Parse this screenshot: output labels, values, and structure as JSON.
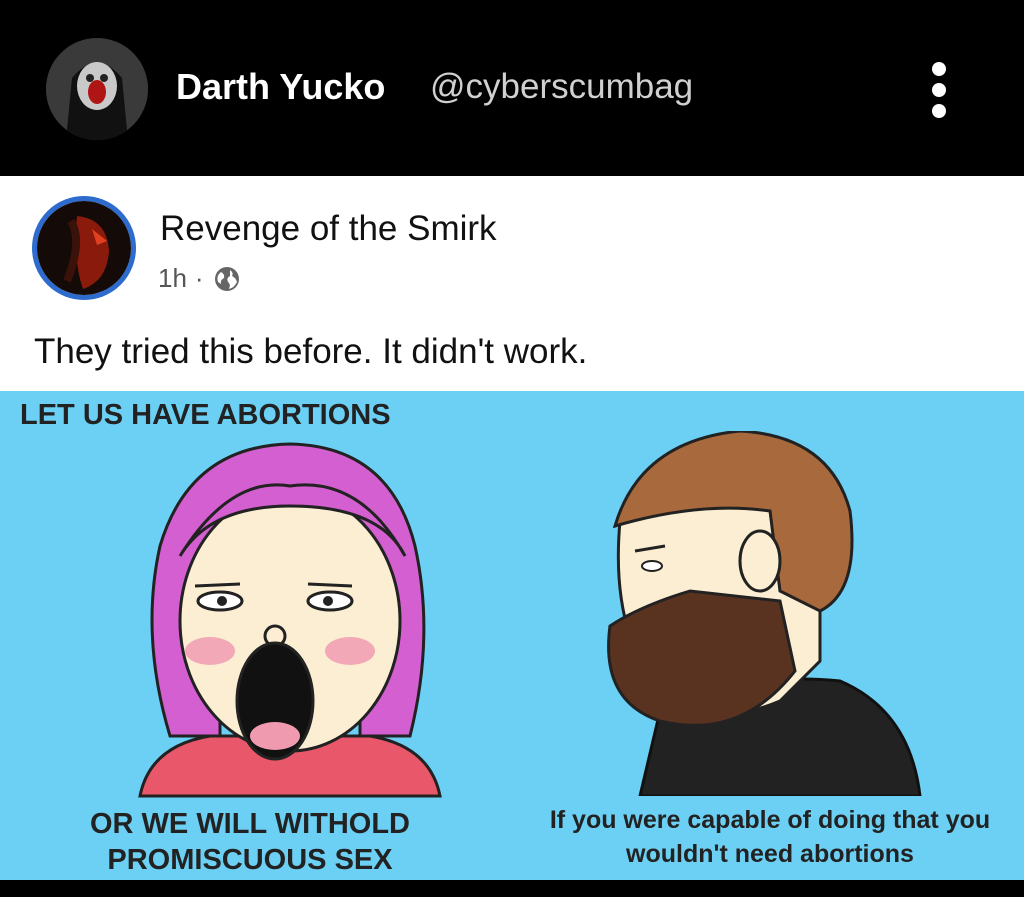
{
  "header": {
    "display_name": "Darth Yucko",
    "handle": "@cyberscumbag"
  },
  "post": {
    "page_name": "Revenge of the Smirk",
    "time": "1h",
    "separator": "·",
    "privacy_icon": "globe-icon",
    "caption": "They tried this before. It didn't work."
  },
  "meme": {
    "top_text": "LET US HAVE ABORTIONS",
    "left_bottom_text": "OR WE WILL WITHOLD PROMISCUOUS SEX",
    "right_bottom_text": "If you were capable of doing that you wouldn't need abortions",
    "background_color": "#6cd0f5"
  },
  "icons": {
    "more": "more-vertical-icon"
  }
}
